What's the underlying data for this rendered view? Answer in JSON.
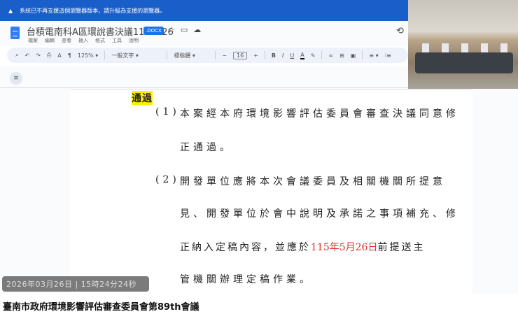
{
  "banner": {
    "text": "系統已不再支援這個瀏覽器版本，請升級為支援的瀏覽器。"
  },
  "doc": {
    "title": "台積電南科A區環說書決議1150326",
    "badge": ".DOCX",
    "menu": [
      "檔案",
      "編輯",
      "查看",
      "插入",
      "格式",
      "工具",
      "說明"
    ]
  },
  "toolbar": {
    "zoom": "125%",
    "style": "一般文字",
    "font": "標楷體",
    "font_size": "16"
  },
  "content": {
    "heading": "通過",
    "item1_num": "(1)",
    "item1_l1": "本案經本府環境影響評估委員會審查決議同意修",
    "item1_l2": "正通過。",
    "item2_num": "(2)",
    "item2_l1": "開發單位應將本次會議委員及相關機關所提意",
    "item2_l2": "見、開發單位於會中說明及承諾之事項補充、修",
    "item2_l3a": "正納入定稿內容，並應於",
    "item2_date": "115年5月26日",
    "item2_l3b": "前提送主",
    "item2_l4": "管機關辦理定稿作業。"
  },
  "timestamp": "2026年03月26日 | 15時24分24秒",
  "caption": "臺南市政府環境影響評估審查委員會第89th會議"
}
